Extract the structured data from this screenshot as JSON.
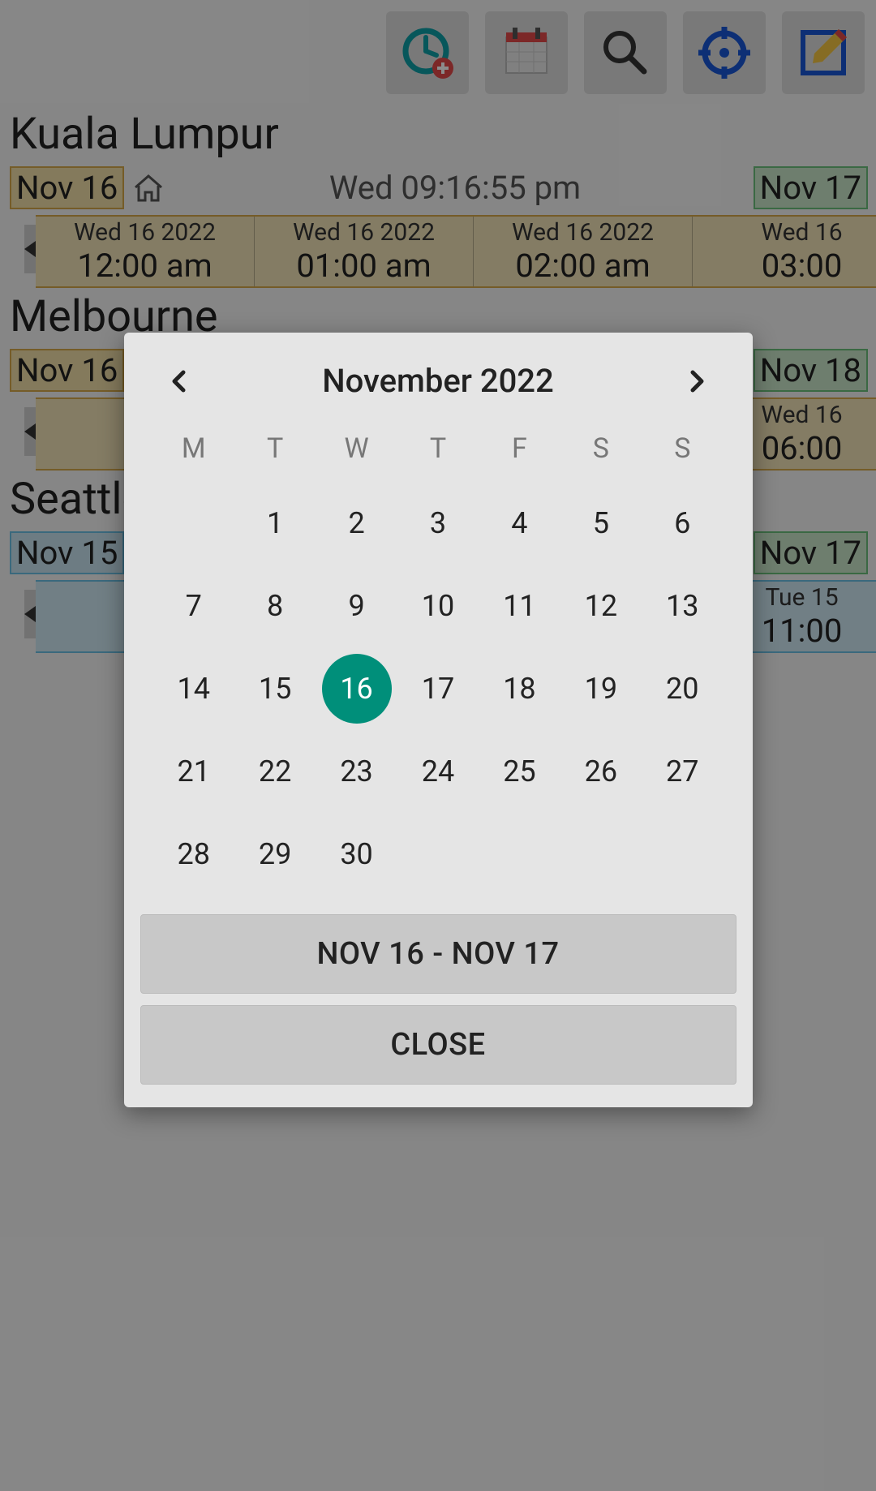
{
  "toolbar_icons": [
    "clock-add-icon",
    "calendar-icon",
    "search-icon",
    "target-icon",
    "edit-icon"
  ],
  "cities": [
    {
      "name": "Kuala Lumpur",
      "start_badge": "Nov 16",
      "is_home": true,
      "clock": "Wed 09:16:55 pm",
      "end_badge": "Nov 17",
      "style": "warm",
      "timeline": [
        {
          "date": "Wed 16 2022",
          "time": "12:00 am"
        },
        {
          "date": "Wed 16 2022",
          "time": "01:00 am"
        },
        {
          "date": "Wed 16 2022",
          "time": "02:00 am"
        },
        {
          "date": "Wed 16",
          "time": "03:00"
        }
      ]
    },
    {
      "name": "Melbourne",
      "start_badge": "Nov 16",
      "end_badge": "Nov 18",
      "style": "warm",
      "timeline": [
        {
          "date": "",
          "time": ""
        },
        {
          "date": "",
          "time": ""
        },
        {
          "date": "",
          "time": ""
        },
        {
          "date": "Wed 16",
          "time": "06:00"
        }
      ]
    },
    {
      "name": "Seattle",
      "start_badge": "Nov 15",
      "end_badge": "Nov 17",
      "style": "blue",
      "timeline": [
        {
          "date": "",
          "time": ""
        },
        {
          "date": "",
          "time": ""
        },
        {
          "date": "",
          "time": ""
        },
        {
          "date": "Tue 15",
          "time": "11:00"
        }
      ]
    }
  ],
  "dialog": {
    "month_title": "November 2022",
    "dow": [
      "M",
      "T",
      "W",
      "T",
      "F",
      "S",
      "S"
    ],
    "leading_blanks": 1,
    "days_in_month": 30,
    "selected_day": 16,
    "range_button": "NOV 16 - NOV 17",
    "close_button": "CLOSE"
  }
}
